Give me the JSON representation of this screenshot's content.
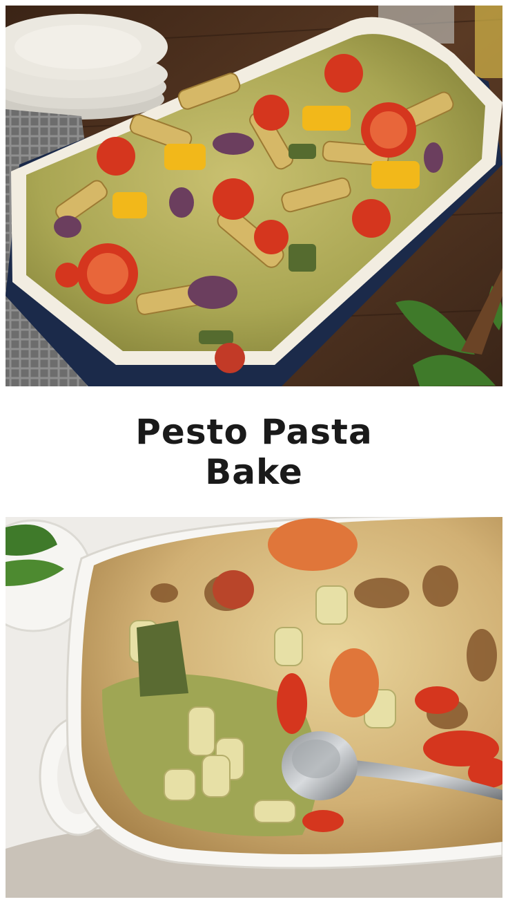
{
  "pin": {
    "title": "Pesto Pasta Bake"
  },
  "colors": {
    "background": "#ffffff",
    "title_text": "#1a1a1a",
    "wood_table": "#4a2f1d",
    "dish_navy": "#1b2a4a",
    "dish_cream": "#f2ede1",
    "pesto_green": "#9aa54a",
    "tomato_red": "#d5361e",
    "pepper_yellow": "#f2b81a",
    "basil_green": "#3f7a2a",
    "cheese_brown": "#a9642a"
  },
  "images": [
    {
      "name": "photo-top",
      "alt": "baked pesto penne with roasted tomatoes, yellow peppers and red onion in a navy baking dish"
    },
    {
      "name": "photo-bottom",
      "alt": "cheesy pesto rigatoni bake with a serving spoon in a white dish"
    }
  ]
}
